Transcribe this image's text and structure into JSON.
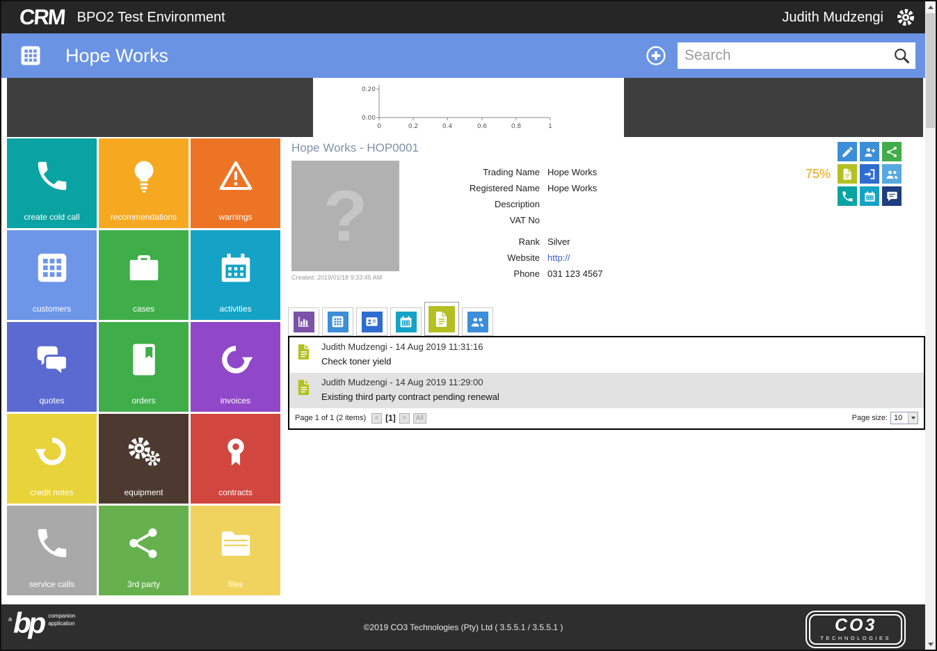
{
  "topbar": {
    "logo": "CRM",
    "title": "BPO2 Test Environment",
    "user": "Judith Mudzengi"
  },
  "header": {
    "title": "Hope Works",
    "search_placeholder": "Search",
    "icon_color": "#6a93e4"
  },
  "mini_chart": {
    "y_ticks": [
      "0.20",
      "0.00"
    ],
    "x_ticks": [
      "0",
      "0.2",
      "0.4",
      "0.6",
      "0.8",
      "1"
    ]
  },
  "tiles": [
    {
      "label": "create cold call",
      "icon": "phone",
      "color": "#0aa3a3"
    },
    {
      "label": "recommendations",
      "icon": "lightbulb",
      "color": "#f6a821"
    },
    {
      "label": "warnings",
      "icon": "warning-triangle",
      "color": "#ed7424"
    },
    {
      "label": "customers",
      "icon": "building-grid",
      "color": "#6e96e8"
    },
    {
      "label": "cases",
      "icon": "briefcase",
      "color": "#3fae49"
    },
    {
      "label": "activities",
      "icon": "calendar",
      "color": "#14a3c6"
    },
    {
      "label": "quotes",
      "icon": "speech-bubbles",
      "color": "#5a6ad0"
    },
    {
      "label": "orders",
      "icon": "book",
      "color": "#3fae49"
    },
    {
      "label": "invoices",
      "icon": "redo-arrow",
      "color": "#9048c8"
    },
    {
      "label": "credit notes",
      "icon": "undo-arrow",
      "color": "#e9d33b"
    },
    {
      "label": "equipment",
      "icon": "gears",
      "color": "#4c3a30"
    },
    {
      "label": "contracts",
      "icon": "award-ribbon",
      "color": "#d1473f"
    },
    {
      "label": "service calls",
      "icon": "phone",
      "color": "#a9a9a9"
    },
    {
      "label": "3rd party",
      "icon": "share-nodes",
      "color": "#66b14e"
    },
    {
      "label": "files",
      "icon": "folder",
      "color": "#efd35e"
    }
  ],
  "customer": {
    "title": "Hope Works - HOP0001",
    "photo_placeholder": "?",
    "created": "Created: 2019/01/18 9:33:45 AM",
    "completeness": "75%",
    "fields": [
      {
        "label": "Trading Name",
        "value": "Hope Works"
      },
      {
        "label": "Registered Name",
        "value": "Hope Works"
      },
      {
        "label": "Description",
        "value": ""
      },
      {
        "label": "VAT No",
        "value": ""
      },
      {
        "label": "Rank",
        "value": "Silver"
      },
      {
        "label": "Website",
        "value": "http://"
      },
      {
        "label": "Phone",
        "value": "031 123 4567"
      }
    ]
  },
  "action_icons": [
    {
      "name": "edit",
      "color": "#3d8ed8"
    },
    {
      "name": "add-person",
      "color": "#3d8ed8"
    },
    {
      "name": "share",
      "color": "#41ac49"
    },
    {
      "name": "note",
      "color": "#b4c022"
    },
    {
      "name": "sign-out",
      "color": "#2f6cd0"
    },
    {
      "name": "people",
      "color": "#58a8e0"
    },
    {
      "name": "call",
      "color": "#0aa3a3"
    },
    {
      "name": "calendar",
      "color": "#14a3c6"
    },
    {
      "name": "chat",
      "color": "#1e3e7e"
    }
  ],
  "tabs": [
    {
      "name": "dashboard",
      "color": "#7b52a8",
      "active": false
    },
    {
      "name": "company",
      "color": "#3d8ed8",
      "active": false
    },
    {
      "name": "contacts",
      "color": "#2f6cd0",
      "active": false
    },
    {
      "name": "activities",
      "color": "#14a3c6",
      "active": false
    },
    {
      "name": "notes",
      "color": "#b4c022",
      "active": true
    },
    {
      "name": "people",
      "color": "#3d8ed8",
      "active": false
    }
  ],
  "notes": {
    "icon_color": "#b4c022",
    "items": [
      {
        "author_line": "Judith Mudzengi - 14 Aug 2019 11:31:16",
        "text": "Check toner yield"
      },
      {
        "author_line": "Judith Mudzengi - 14 Aug 2019 11:29:00",
        "text": "Existing third party contract pending renewal"
      }
    ],
    "pager": {
      "status": "Page 1 of 1 (2 items)",
      "prev": "<",
      "current": "[1]",
      "next": ">",
      "all_label": "All",
      "page_size_label": "Page size:",
      "page_size": "10"
    }
  },
  "footer": {
    "copyright": "©2019 CO3 Technologies (Pty) Ltd ( 3.5.5.1 / 3.5.5.1 )",
    "bp_prefix": "a",
    "bp_mark": "bp",
    "bp_line1": "companion",
    "bp_line2": "application",
    "co3_name": "CO3",
    "co3_sub": "TECHNOLOGIES"
  }
}
